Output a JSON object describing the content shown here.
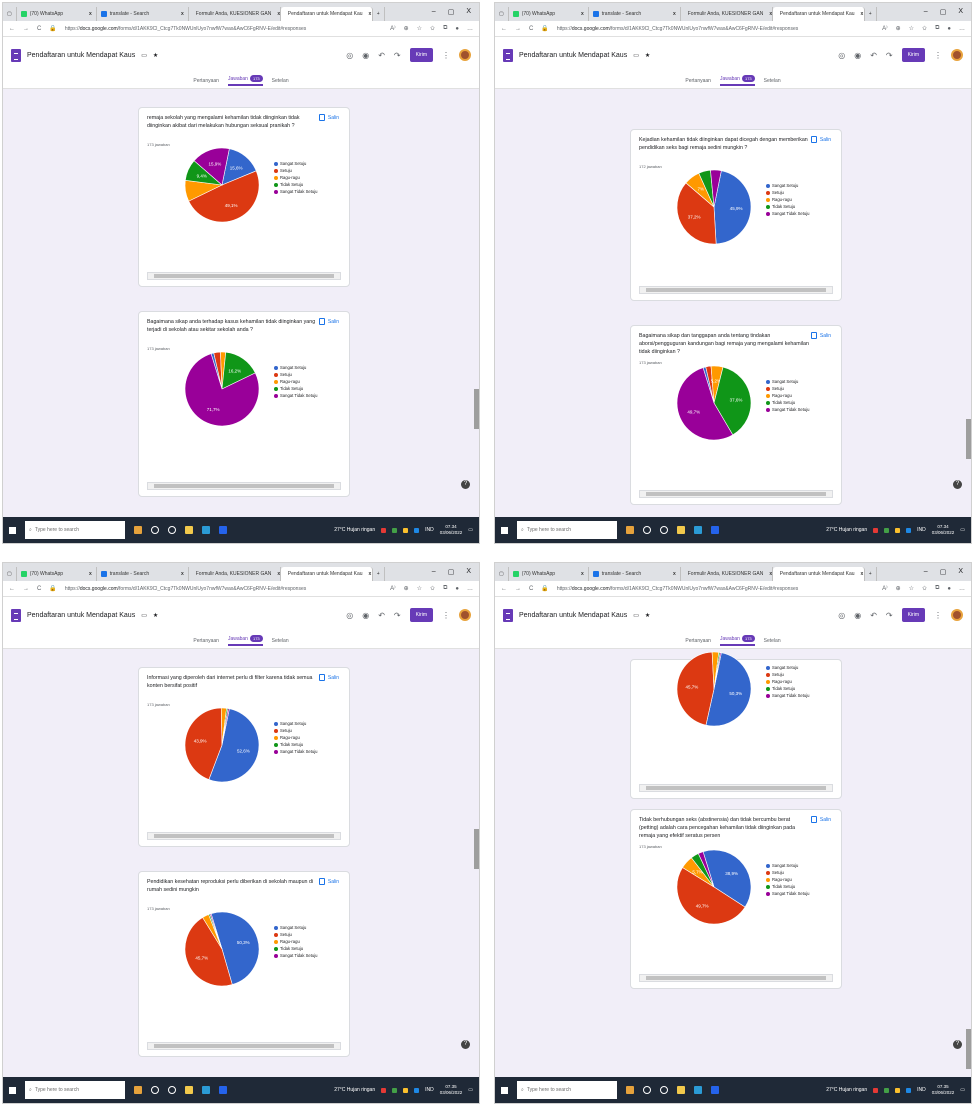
{
  "browser": {
    "tabs": [
      {
        "label": "(70) WhatsApp",
        "color": "#25d366"
      },
      {
        "label": "translate - Search",
        "color": "#1a73e8"
      },
      {
        "label": "Formulir Anda, KUESIONER GAN",
        "color": "#c5221f"
      },
      {
        "label": "Pendaftaran untuk Mendapat Kau",
        "color": "#673ab7"
      }
    ],
    "new_tab": "+",
    "url_prefix": "https://",
    "url_host": "docs.google.com",
    "url_path": "/forms/d/1AKK9Cl_Ctcg7Tk0NWUnlUyo7nwfW7wax&AwC6FgRNV-E/edit#responses",
    "min": "–",
    "max": "▢",
    "close": "X"
  },
  "app": {
    "form_title": "Pendaftaran untuk Mendapat Kaus",
    "send_label": "Kirim"
  },
  "subtabs": {
    "questions": "Pertanyaan",
    "responses": "Jawaban",
    "responses_count": "173",
    "settings": "Setelan"
  },
  "copy_label": "Salin",
  "legend_labels": [
    "Sangat Setuju",
    "Setuju",
    "Ragu-ragu",
    "Tidak Setuju",
    "Sangat Tidak Setuju"
  ],
  "legend_colors": [
    "#3366cc",
    "#dc3912",
    "#ff9900",
    "#109618",
    "#990099"
  ],
  "taskbar": {
    "search_placeholder": "Type here to search",
    "weather": "27°C Hujan ringan",
    "lang": "IND",
    "screens": [
      {
        "time": "07.34",
        "date": "03/06/2022"
      },
      {
        "time": "07.34",
        "date": "03/06/2022"
      },
      {
        "time": "07.35",
        "date": "03/06/2022"
      },
      {
        "time": "07.35",
        "date": "03/06/2022"
      }
    ]
  },
  "chart_data": [
    {
      "type": "pie",
      "title": "remaja sekolah yang mengalami kehamilan tidak diinginkan tidak diinginkan akibat dari melakukan hubungan seksual pranikah ?",
      "count": "173 jawaban",
      "categories": [
        "Sangat Setuju",
        "Setuju",
        "Ragu-ragu",
        "Tidak Setuju",
        "Sangat Tidak Setuju"
      ],
      "values": [
        15.6,
        49.1,
        9.2,
        9.4,
        16.8
      ],
      "labels": [
        "15,6%",
        "49,1%",
        "",
        "9,4%",
        "15,9%"
      ]
    },
    {
      "type": "pie",
      "title": "Bagaimana sikap anda terhadap kasus kehamilan tidak diinginkan yang terjadi di sekolah atau sekitar sekolah anda ?",
      "count": "173 jawaban",
      "categories": [
        "Sangat Setuju",
        "Setuju",
        "Ragu-ragu",
        "Tidak Setuju",
        "Sangat Tidak Setuju"
      ],
      "values": [
        1.2,
        2.9,
        2.3,
        16.2,
        77.4
      ],
      "labels": [
        "",
        "",
        "",
        "16,2%",
        "71,7%"
      ]
    },
    {
      "type": "pie",
      "title": "Kejadian kehamilan tidak diinginkan dapat dicegah dengan memberikan pendidikan seks bagi remaja sedini mungkin ?",
      "count": "172 jawaban",
      "categories": [
        "Sangat Setuju",
        "Setuju",
        "Ragu-ragu",
        "Tidak Setuju",
        "Sangat Tidak Setuju"
      ],
      "values": [
        45.9,
        37.2,
        7.0,
        5.2,
        4.7
      ],
      "labels": [
        "45,9%",
        "37,2%",
        "7%",
        "",
        ""
      ]
    },
    {
      "type": "pie",
      "title": "Bagaimana sikap dan tanggapan anda tentang tindakan aborsi/pengguguran kandungan bagi remaja yang mengalami kehamilan tidak diinginkan ?",
      "count": "173 jawaban",
      "categories": [
        "Sangat Setuju",
        "Setuju",
        "Ragu-ragu",
        "Tidak Setuju",
        "Sangat Tidak Setuju"
      ],
      "values": [
        1.2,
        2.3,
        5.2,
        37.6,
        53.7
      ],
      "labels": [
        "",
        "",
        "5,2%",
        "37,6%",
        "49,7%"
      ]
    },
    {
      "type": "pie",
      "title": "Informasi yang diperoleh dari internet perlu di filter karena tidak semua konten bersifat positif",
      "count": "173 jawaban",
      "categories": [
        "Sangat Setuju",
        "Setuju",
        "Ragu-ragu",
        "Tidak Setuju",
        "Sangat Tidak Setuju"
      ],
      "values": [
        52.6,
        43.9,
        2.3,
        0.6,
        0.6
      ],
      "labels": [
        "52,6%",
        "43,9%",
        "",
        "",
        ""
      ]
    },
    {
      "type": "pie",
      "title": "Pendidikan kesehatan reproduksi perlu diberikan di sekolah maupun di rumah sedini mungkin",
      "count": "173 jawaban",
      "categories": [
        "Sangat Setuju",
        "Setuju",
        "Ragu-ragu",
        "Tidak Setuju",
        "Sangat Tidak Setuju"
      ],
      "values": [
        50.3,
        45.7,
        2.9,
        0.6,
        0.5
      ],
      "labels": [
        "50,3%",
        "45,7%",
        "",
        "",
        ""
      ]
    },
    {
      "type": "pie",
      "title": "",
      "count": "",
      "categories": [
        "Sangat Setuju",
        "Setuju",
        "Ragu-ragu",
        "Tidak Setuju",
        "Sangat Tidak Setuju"
      ],
      "values": [
        50.3,
        45.7,
        2.9,
        0.6,
        0.5
      ],
      "labels": [
        "50,3%",
        "45,7%",
        "",
        "",
        ""
      ]
    },
    {
      "type": "pie",
      "title": "Tidak berhubungan seks (abstinensia) dan tidak bercumbu berat (petting) adalah cara pencegahan kehamilan tidak diinginkan pada remaja yang efektif seratus persen",
      "count": "173 jawaban",
      "categories": [
        "Sangat Setuju",
        "Setuju",
        "Ragu-ragu",
        "Tidak Setuju",
        "Sangat Tidak Setuju"
      ],
      "values": [
        38.9,
        49.7,
        5.7,
        3.5,
        2.2
      ],
      "labels": [
        "38,9%",
        "49,7%",
        "5,7%",
        "",
        ""
      ]
    }
  ]
}
